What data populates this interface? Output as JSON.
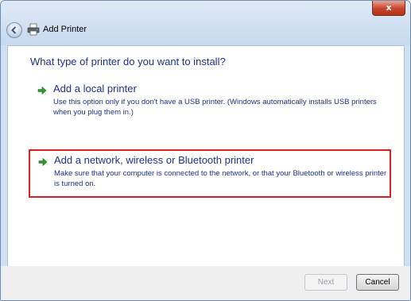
{
  "window": {
    "title": "Add Printer",
    "close_glyph": "x",
    "back_icon": "back-arrow-icon",
    "title_icon": "printer-icon"
  },
  "main": {
    "question": "What type of printer do you want to install?",
    "options": [
      {
        "title": "Add a local printer",
        "description": "Use this option only if you don't have a USB printer. (Windows automatically installs USB printers when you plug them in.)",
        "icon": "green-arrow-icon"
      },
      {
        "title": "Add a network, wireless or Bluetooth printer",
        "description": "Make sure that your computer is connected to the network, or that your Bluetooth or wireless printer is turned on.",
        "icon": "green-arrow-icon",
        "highlighted": true
      }
    ]
  },
  "footer": {
    "next_label": "Next",
    "cancel_label": "Cancel",
    "next_enabled": false
  },
  "colors": {
    "link_text": "#1e3287",
    "highlight_border": "#e02020",
    "arrow_green": "#2e9b2e",
    "close_button": "#c8432a"
  }
}
